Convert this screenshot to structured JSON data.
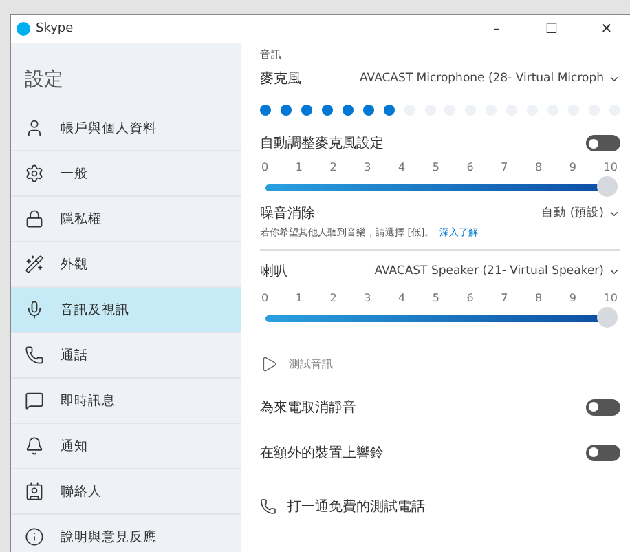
{
  "window": {
    "title": "Skype",
    "controls": [
      "–",
      "☐",
      "✕"
    ]
  },
  "sidebar": {
    "title": "設定",
    "items": [
      {
        "label": "帳戶與個人資料",
        "selected": false
      },
      {
        "label": "一般",
        "selected": false
      },
      {
        "label": "隱私權",
        "selected": false
      },
      {
        "label": "外觀",
        "selected": false
      },
      {
        "label": "音訊及視訊",
        "selected": true
      },
      {
        "label": "通話",
        "selected": false
      },
      {
        "label": "即時訊息",
        "selected": false
      },
      {
        "label": "通知",
        "selected": false
      },
      {
        "label": "聯絡人",
        "selected": false
      },
      {
        "label": "說明與意見反應",
        "selected": false
      }
    ]
  },
  "audio": {
    "section": "音訊",
    "microphone": {
      "label": "麥克風",
      "device": "AVACAST Microphone (28- Virtual Microph",
      "level": 0.39
    },
    "auto_adjust": {
      "label": "自動調整麥克風設定",
      "on": false
    },
    "mic_volume": {
      "ticks": [
        "0",
        "1",
        "2",
        "3",
        "4",
        "5",
        "6",
        "7",
        "8",
        "9",
        "10"
      ],
      "level": 1
    },
    "noise": {
      "label": "噪音消除",
      "value": "自動 (預設)",
      "description": "若你希望其他人聽到音樂，請選擇 [低]。",
      "link": "深入了解"
    },
    "speaker": {
      "label": "喇叭",
      "device": "AVACAST Speaker (21- Virtual Speaker)"
    },
    "speaker_volume": {
      "ticks": [
        "0",
        "1",
        "2",
        "3",
        "4",
        "5",
        "6",
        "7",
        "8",
        "9",
        "10"
      ],
      "level": 1
    },
    "test_audio": "測試音訊",
    "toggles": [
      {
        "label": "為來電取消靜音",
        "on": false
      },
      {
        "label": "在額外的裝置上響鈴",
        "on": false
      }
    ],
    "test_call": "打一通免費的測試電話"
  }
}
